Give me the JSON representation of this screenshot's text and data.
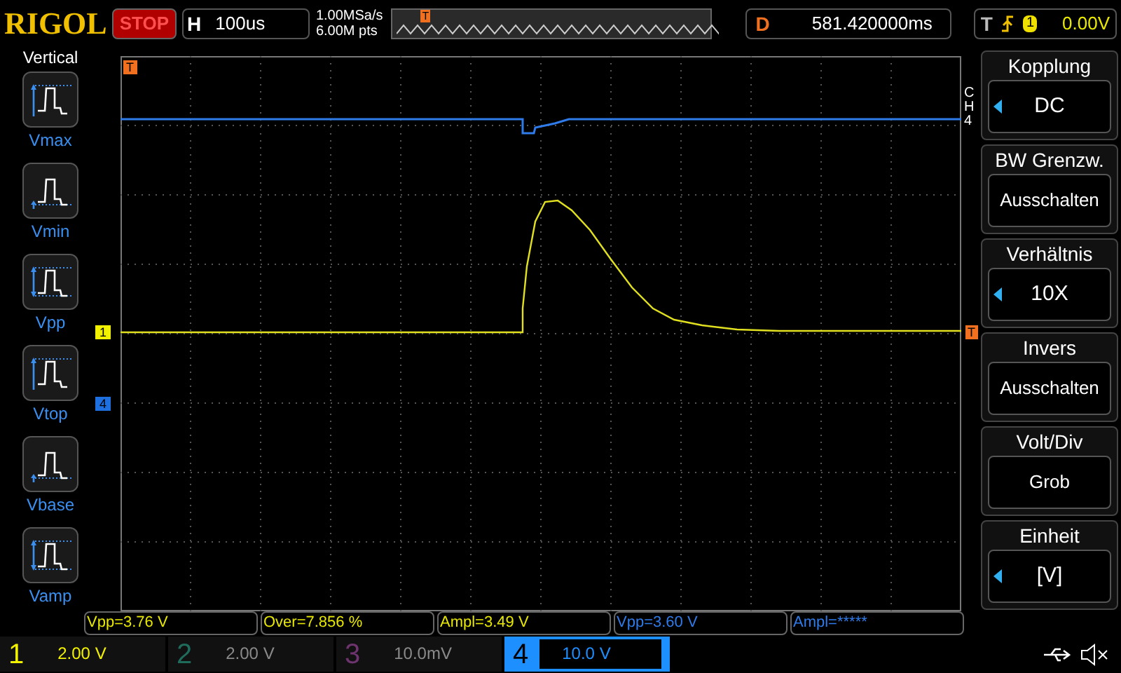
{
  "header": {
    "brand": "RIGOL",
    "run_state": "STOP",
    "timebase": {
      "label": "H",
      "value": "100us"
    },
    "sample_rate": "1.00MSa/s",
    "memory_depth": "6.00M pts",
    "trigger_position_marker": "T",
    "delay": {
      "label": "D",
      "value": "581.420000ms"
    },
    "trigger": {
      "label": "T",
      "source": "1",
      "level": "0.00V"
    }
  },
  "left_menu": {
    "title": "Vertical",
    "items": [
      {
        "label": "Vmax",
        "kind": "vmax"
      },
      {
        "label": "Vmin",
        "kind": "vmin"
      },
      {
        "label": "Vpp",
        "kind": "vpp"
      },
      {
        "label": "Vtop",
        "kind": "vtop"
      },
      {
        "label": "Vbase",
        "kind": "vbase"
      },
      {
        "label": "Vamp",
        "kind": "vamp"
      }
    ]
  },
  "graticule": {
    "markers": [
      {
        "text": "T",
        "kind": "trigger_time"
      },
      {
        "text": "1",
        "kind": "channel",
        "color": "#f2f200"
      },
      {
        "text": "4",
        "kind": "channel",
        "color": "#1e6fe0"
      },
      {
        "text": "T",
        "kind": "trigger_level"
      }
    ]
  },
  "right_menu": {
    "channel_label": "CH4",
    "items": [
      {
        "title": "Kopplung",
        "value": "DC",
        "adjustable": true
      },
      {
        "title": "BW Grenzw.",
        "value": "Ausschalten",
        "adjustable": false
      },
      {
        "title": "Verhältnis",
        "value": "10X",
        "adjustable": true
      },
      {
        "title": "Invers",
        "value": "Ausschalten",
        "adjustable": false
      },
      {
        "title": "Volt/Div",
        "value": "Grob",
        "adjustable": false
      },
      {
        "title": "Einheit",
        "value": "[V]",
        "adjustable": true
      }
    ]
  },
  "measurements": [
    {
      "text": "Vpp=3.76 V",
      "color": "#e8e800"
    },
    {
      "text": "Over=7.856 %",
      "color": "#e8e800"
    },
    {
      "text": "Ampl=3.49 V",
      "color": "#e8e800"
    },
    {
      "text": "Vpp=3.60 V",
      "color": "#2f7bea"
    },
    {
      "text": "Ampl=*****",
      "color": "#2f7bea"
    }
  ],
  "channels": [
    {
      "number": "1",
      "scale": "2.00 V",
      "on": true,
      "selected": false,
      "color": "#f2f200"
    },
    {
      "number": "2",
      "scale": "2.00 V",
      "on": false,
      "selected": false,
      "color": "#1f6b5c"
    },
    {
      "number": "3",
      "scale": "10.0mV",
      "on": false,
      "selected": false,
      "color": "#6e3470"
    },
    {
      "number": "4",
      "scale": "10.0 V",
      "on": true,
      "selected": true,
      "color": "#1e8fff"
    }
  ]
}
